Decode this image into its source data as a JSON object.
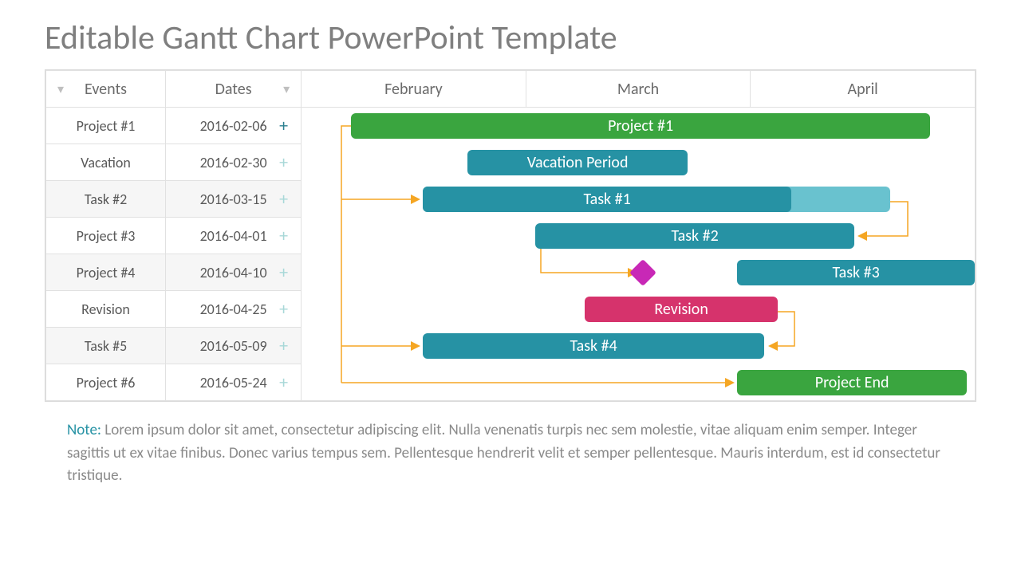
{
  "title": "Editable Gantt Chart PowerPoint Template",
  "headers": {
    "events": "Events",
    "dates": "Dates",
    "months": [
      "February",
      "March",
      "April"
    ]
  },
  "rows": [
    {
      "event": "Project #1",
      "date": "2016-02-06"
    },
    {
      "event": "Vacation",
      "date": "2016-02-30"
    },
    {
      "event": "Task #2",
      "date": "2016-03-15"
    },
    {
      "event": "Project #3",
      "date": "2016-04-01"
    },
    {
      "event": "Project #4",
      "date": "2016-04-10"
    },
    {
      "event": "Revision",
      "date": "2016-04-25"
    },
    {
      "event": "Task #5",
      "date": "2016-05-09"
    },
    {
      "event": "Project #6",
      "date": "2016-05-24"
    }
  ],
  "bars": {
    "project1": "Project #1",
    "vacation": "Vacation Period",
    "task1": "Task #1",
    "task2": "Task #2",
    "task3": "Task #3",
    "revision": "Revision",
    "task4": "Task #4",
    "projectend": "Project End"
  },
  "note_label": "Note:",
  "note_body": " Lorem ipsum dolor sit amet, consectetur adipiscing elit. Nulla venenatis turpis nec sem molestie, vitae aliquam enim semper. Integer sagittis ut ex vitae finibus. Donec varius tempus sem. Pellentesque hendrerit velit et semper pellentesque. Mauris interdum, est id consectetur tristique.",
  "chart_data": {
    "type": "bar",
    "title": "Editable Gantt Chart PowerPoint Template",
    "xlabel": "",
    "ylabel": "",
    "x_ticks": [
      "February",
      "March",
      "April"
    ],
    "x_unit_count": 15,
    "series": [
      {
        "name": "Project #1",
        "row": 0,
        "start_unit": 1.1,
        "end_unit": 14.0,
        "color": "green",
        "label": "Project #1"
      },
      {
        "name": "Vacation",
        "row": 1,
        "start_unit": 3.7,
        "end_unit": 8.6,
        "color": "teal",
        "label": "Vacation Period"
      },
      {
        "name": "Task #1",
        "row": 2,
        "start_unit": 2.7,
        "end_unit": 10.9,
        "color": "teal",
        "label": "Task #1",
        "progress_end_unit": 13.1,
        "progress_color": "teal-light"
      },
      {
        "name": "Task #2",
        "row": 3,
        "start_unit": 5.2,
        "end_unit": 12.3,
        "color": "teal",
        "label": "Task #2"
      },
      {
        "name": "Milestone",
        "row": 4,
        "at_unit": 7.6,
        "shape": "diamond",
        "color": "magenta"
      },
      {
        "name": "Task #3",
        "row": 4,
        "start_unit": 9.7,
        "end_unit": 15.0,
        "color": "teal",
        "label": "Task #3"
      },
      {
        "name": "Revision",
        "row": 5,
        "start_unit": 6.3,
        "end_unit": 10.6,
        "color": "pink",
        "label": "Revision"
      },
      {
        "name": "Task #4",
        "row": 6,
        "start_unit": 2.7,
        "end_unit": 10.3,
        "color": "teal",
        "label": "Task #4"
      },
      {
        "name": "Project End",
        "row": 7,
        "start_unit": 9.7,
        "end_unit": 14.8,
        "color": "green",
        "label": "Project End"
      }
    ],
    "dependencies": [
      {
        "from": "Project #1.start",
        "to": "Task #1.start"
      },
      {
        "from": "Project #1.start",
        "to": "Task #4.start"
      },
      {
        "from": "Project #1.start",
        "to": "Project End.start"
      },
      {
        "from": "Task #2.start",
        "to": "Milestone"
      },
      {
        "from": "Task #1.progress_end",
        "to": "Task #2.end"
      },
      {
        "from": "Revision.end",
        "to": "Task #4.end"
      }
    ],
    "categories": [
      "Project #1",
      "Vacation",
      "Task #2",
      "Project #3",
      "Project #4",
      "Revision",
      "Task #5",
      "Project #6"
    ],
    "dates": [
      "2016-02-06",
      "2016-02-30",
      "2016-03-15",
      "2016-04-01",
      "2016-04-10",
      "2016-04-25",
      "2016-05-09",
      "2016-05-24"
    ]
  }
}
